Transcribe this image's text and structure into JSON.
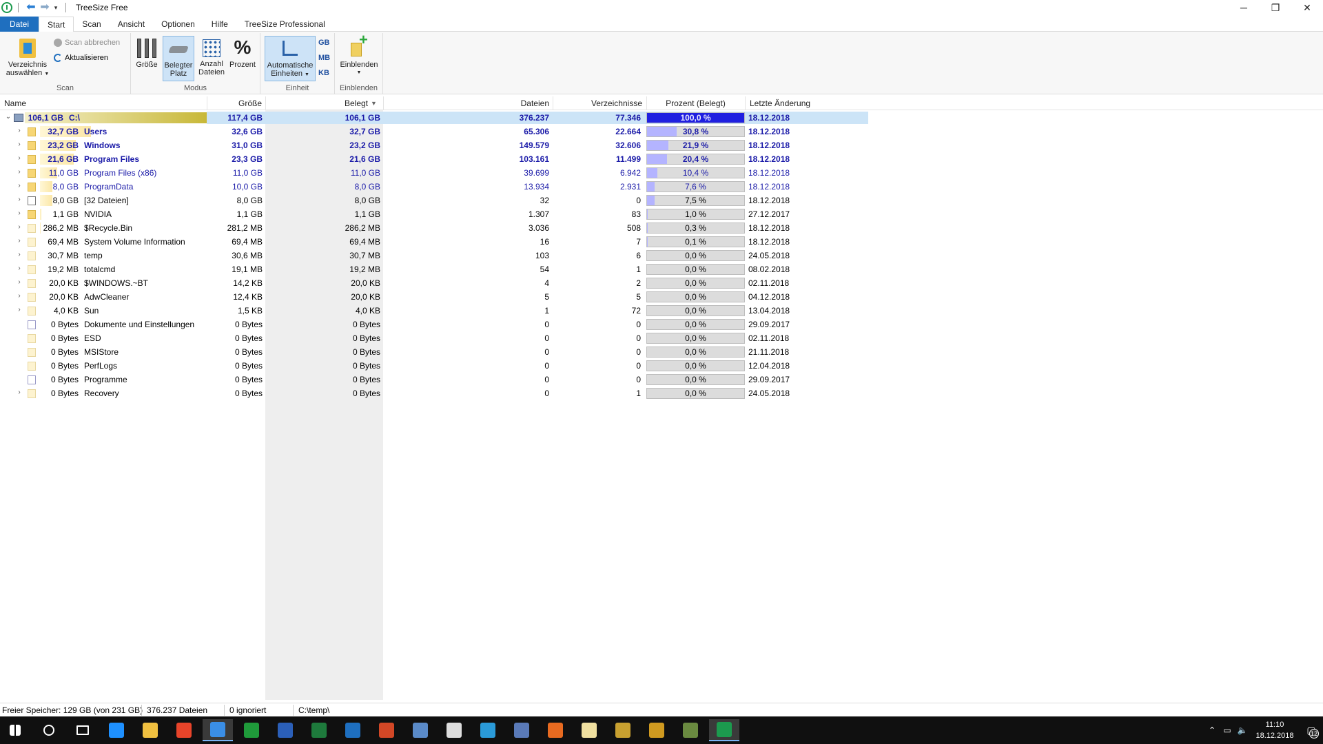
{
  "window": {
    "title": "TreeSize Free",
    "controls": {
      "minimize": "─",
      "maximize": "❐",
      "close": "✕"
    }
  },
  "menu_tabs": [
    {
      "label": "Datei"
    },
    {
      "label": "Start"
    },
    {
      "label": "Scan"
    },
    {
      "label": "Ansicht"
    },
    {
      "label": "Optionen"
    },
    {
      "label": "Hilfe"
    },
    {
      "label": "TreeSize Professional"
    }
  ],
  "ribbon": {
    "scan": {
      "group_label": "Scan",
      "select_dir_l1": "Verzeichnis",
      "select_dir_l2": "auswählen",
      "abort_scan": "Scan abbrechen",
      "refresh": "Aktualisieren"
    },
    "modus": {
      "group_label": "Modus",
      "size": "Größe",
      "occupied_l1": "Belegter",
      "occupied_l2": "Platz",
      "count_l1": "Anzahl",
      "count_l2": "Dateien",
      "percent": "Prozent"
    },
    "einheit": {
      "group_label": "Einheit",
      "auto_l1": "Automatische",
      "auto_l2": "Einheiten",
      "gb": "GB",
      "mb": "MB",
      "kb": "KB"
    },
    "einblenden": {
      "group_label": "Einblenden",
      "show": "Einblenden"
    }
  },
  "columns": {
    "name": "Name",
    "size": "Größe",
    "occupied": "Belegt",
    "files": "Dateien",
    "folders": "Verzeichnisse",
    "percent": "Prozent (Belegt)",
    "modified": "Letzte Änderung"
  },
  "rows": [
    {
      "sizeLabel": "106,1 GB",
      "name": "C:\\",
      "size": "117,4 GB",
      "occupied": "106,1 GB",
      "files": "376.237",
      "folders": "77.346",
      "percent": "100,0 %",
      "pct": 100,
      "modified": "18.12.2018",
      "style": "root"
    },
    {
      "sizeLabel": "32,7 GB",
      "name": "Users",
      "size": "32,6 GB",
      "occupied": "32,7 GB",
      "files": "65.306",
      "folders": "22.664",
      "percent": "30,8 %",
      "pct": 30.8,
      "modified": "18.12.2018",
      "style": "bold"
    },
    {
      "sizeLabel": "23,2 GB",
      "name": "Windows",
      "size": "31,0 GB",
      "occupied": "23,2 GB",
      "files": "149.579",
      "folders": "32.606",
      "percent": "21,9 %",
      "pct": 21.9,
      "modified": "18.12.2018",
      "style": "bold"
    },
    {
      "sizeLabel": "21,6 GB",
      "name": "Program Files",
      "size": "23,3 GB",
      "occupied": "21,6 GB",
      "files": "103.161",
      "folders": "11.499",
      "percent": "20,4 %",
      "pct": 20.4,
      "modified": "18.12.2018",
      "style": "bold"
    },
    {
      "sizeLabel": "11,0 GB",
      "name": "Program Files (x86)",
      "size": "11,0 GB",
      "occupied": "11,0 GB",
      "files": "39.699",
      "folders": "6.942",
      "percent": "10,4 %",
      "pct": 10.4,
      "modified": "18.12.2018",
      "style": "blue"
    },
    {
      "sizeLabel": "8,0 GB",
      "name": "ProgramData",
      "size": "10,0 GB",
      "occupied": "8,0 GB",
      "files": "13.934",
      "folders": "2.931",
      "percent": "7,6 %",
      "pct": 7.6,
      "modified": "18.12.2018",
      "style": "blue"
    },
    {
      "sizeLabel": "8,0 GB",
      "name": "[32 Dateien]",
      "size": "8,0 GB",
      "occupied": "8,0 GB",
      "files": "32",
      "folders": "0",
      "percent": "7,5 %",
      "pct": 7.5,
      "modified": "18.12.2018",
      "style": "file"
    },
    {
      "sizeLabel": "1,1 GB",
      "name": "NVIDIA",
      "size": "1,1 GB",
      "occupied": "1,1 GB",
      "files": "1.307",
      "folders": "83",
      "percent": "1,0 %",
      "pct": 1.0,
      "modified": "27.12.2017",
      "style": "normal"
    },
    {
      "sizeLabel": "286,2 MB",
      "name": "$Recycle.Bin",
      "size": "281,2 MB",
      "occupied": "286,2 MB",
      "files": "3.036",
      "folders": "508",
      "percent": "0,3 %",
      "pct": 0.3,
      "modified": "18.12.2018",
      "style": "normal"
    },
    {
      "sizeLabel": "69,4 MB",
      "name": "System Volume Information",
      "size": "69,4 MB",
      "occupied": "69,4 MB",
      "files": "16",
      "folders": "7",
      "percent": "0,1 %",
      "pct": 0.1,
      "modified": "18.12.2018",
      "style": "normal"
    },
    {
      "sizeLabel": "30,7 MB",
      "name": "temp",
      "size": "30,6 MB",
      "occupied": "30,7 MB",
      "files": "103",
      "folders": "6",
      "percent": "0,0 %",
      "pct": 0,
      "modified": "24.05.2018",
      "style": "normal"
    },
    {
      "sizeLabel": "19,2 MB",
      "name": "totalcmd",
      "size": "19,1 MB",
      "occupied": "19,2 MB",
      "files": "54",
      "folders": "1",
      "percent": "0,0 %",
      "pct": 0,
      "modified": "08.02.2018",
      "style": "normal"
    },
    {
      "sizeLabel": "20,0 KB",
      "name": "$WINDOWS.~BT",
      "size": "14,2 KB",
      "occupied": "20,0 KB",
      "files": "4",
      "folders": "2",
      "percent": "0,0 %",
      "pct": 0,
      "modified": "02.11.2018",
      "style": "normal"
    },
    {
      "sizeLabel": "20,0 KB",
      "name": "AdwCleaner",
      "size": "12,4 KB",
      "occupied": "20,0 KB",
      "files": "5",
      "folders": "5",
      "percent": "0,0 %",
      "pct": 0,
      "modified": "04.12.2018",
      "style": "normal"
    },
    {
      "sizeLabel": "4,0 KB",
      "name": "Sun",
      "size": "1,5 KB",
      "occupied": "4,0 KB",
      "files": "1",
      "folders": "72",
      "percent": "0,0 %",
      "pct": 0,
      "modified": "13.04.2018",
      "style": "normal"
    },
    {
      "sizeLabel": "0 Bytes",
      "name": "Dokumente und Einstellungen",
      "size": "0 Bytes",
      "occupied": "0 Bytes",
      "files": "0",
      "folders": "0",
      "percent": "0,0 %",
      "pct": 0,
      "modified": "29.09.2017",
      "style": "link"
    },
    {
      "sizeLabel": "0 Bytes",
      "name": "ESD",
      "size": "0 Bytes",
      "occupied": "0 Bytes",
      "files": "0",
      "folders": "0",
      "percent": "0,0 %",
      "pct": 0,
      "modified": "02.11.2018",
      "style": "leaf"
    },
    {
      "sizeLabel": "0 Bytes",
      "name": "MSIStore",
      "size": "0 Bytes",
      "occupied": "0 Bytes",
      "files": "0",
      "folders": "0",
      "percent": "0,0 %",
      "pct": 0,
      "modified": "21.11.2018",
      "style": "leaf"
    },
    {
      "sizeLabel": "0 Bytes",
      "name": "PerfLogs",
      "size": "0 Bytes",
      "occupied": "0 Bytes",
      "files": "0",
      "folders": "0",
      "percent": "0,0 %",
      "pct": 0,
      "modified": "12.04.2018",
      "style": "leaf"
    },
    {
      "sizeLabel": "0 Bytes",
      "name": "Programme",
      "size": "0 Bytes",
      "occupied": "0 Bytes",
      "files": "0",
      "folders": "0",
      "percent": "0,0 %",
      "pct": 0,
      "modified": "29.09.2017",
      "style": "link"
    },
    {
      "sizeLabel": "0 Bytes",
      "name": "Recovery",
      "size": "0 Bytes",
      "occupied": "0 Bytes",
      "files": "0",
      "folders": "1",
      "percent": "0,0 %",
      "pct": 0,
      "modified": "24.05.2018",
      "style": "normal"
    }
  ],
  "statusbar": {
    "free": "Freier Speicher: 129 GB  (von 231 GB)",
    "files": "376.237  Dateien",
    "ignored": "0 ignoriert",
    "path": "C:\\temp\\"
  },
  "taskbar": {
    "icons": [
      "windows-start-icon",
      "cortana-icon",
      "task-view-icon",
      "edge-icon",
      "explorer-icon",
      "chrome-icon",
      "app-blue-icon",
      "app-green-icon",
      "word-icon",
      "excel-icon",
      "outlook-icon",
      "powerpoint-icon",
      "network-tool-icon",
      "calculator-icon",
      "internet-explorer-icon",
      "app-sc-icon",
      "firefox-icon",
      "lock-app-icon",
      "lock-app2-icon",
      "audio-app-icon",
      "tree-app-icon",
      "treesize-icon"
    ],
    "time": "11:10",
    "date": "18.12.2018",
    "notifications": "12"
  },
  "colors": {
    "accent": "#1f6fbf",
    "selection": "#cce4f7",
    "percent_bar": "#b4b4ff",
    "percent_bar_root": "#2020e0",
    "bold_blue_text": "#1a1aa8"
  }
}
